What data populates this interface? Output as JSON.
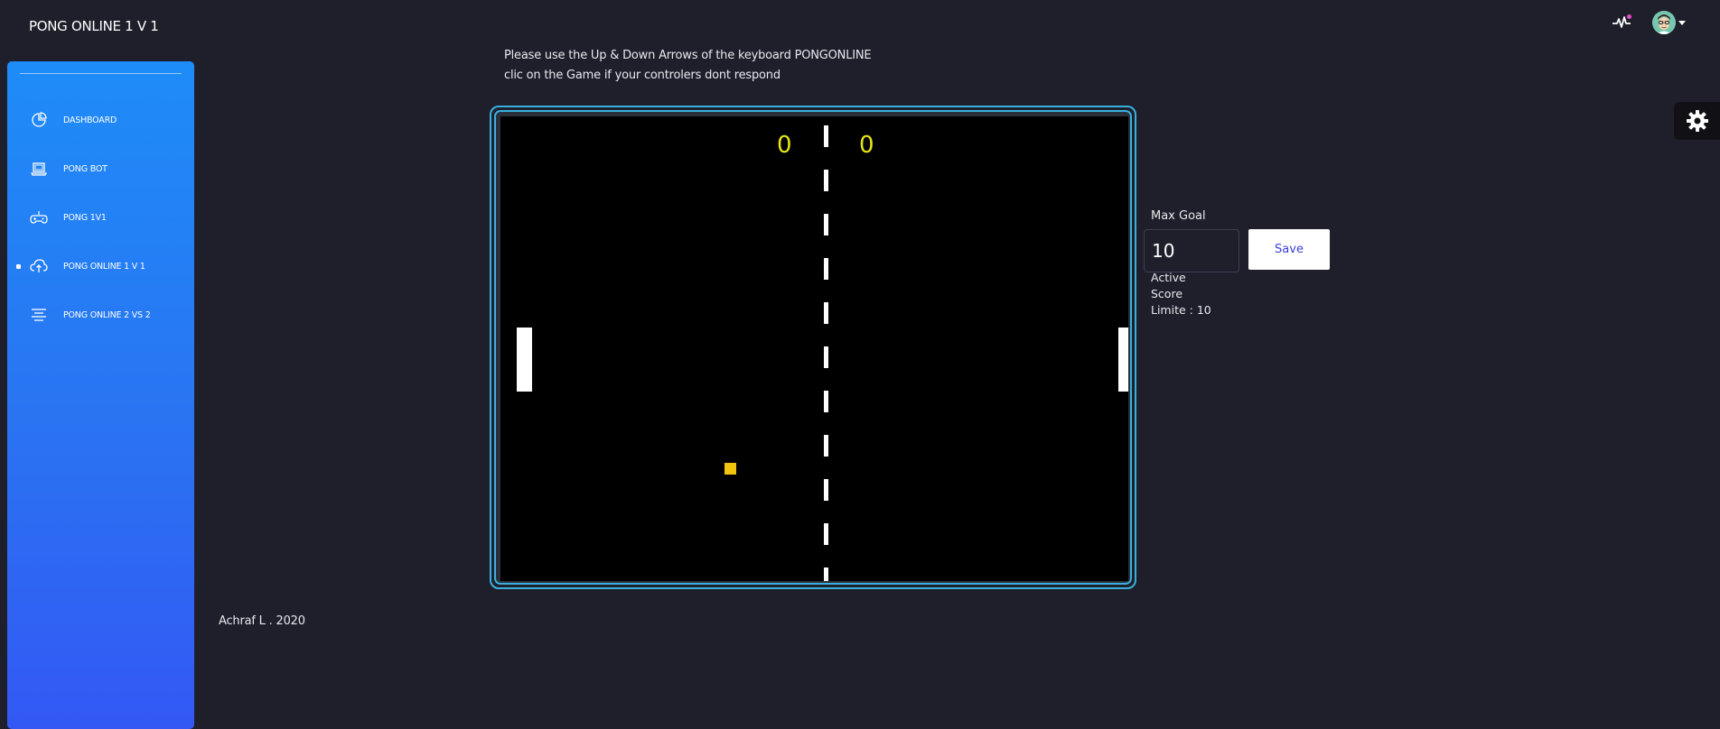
{
  "header": {
    "title": "PONG ONLINE 1 V 1"
  },
  "sidebar": {
    "items": [
      {
        "label": "DASHBOARD",
        "icon": "chart-pie-icon",
        "active": false
      },
      {
        "label": "PONG BOT",
        "icon": "laptop-icon",
        "active": false
      },
      {
        "label": "PONG 1V1",
        "icon": "gamepad-icon",
        "active": false
      },
      {
        "label": "PONG ONLINE 1 V 1",
        "icon": "cloud-upload-icon",
        "active": true
      },
      {
        "label": "PONG ONLINE 2 VS 2",
        "icon": "align-center-icon",
        "active": false
      }
    ]
  },
  "instructions": {
    "line1": "Please use the Up & Down Arrows of the keyboard PONGONLINE",
    "line2": "clic on the Game if your controlers dont respond"
  },
  "game": {
    "score_left": "0",
    "score_right": "0",
    "colors": {
      "court": "#000000",
      "score": "#e5e516",
      "ball": "#f1c40f",
      "paddle": "#ffffff",
      "frame": "#38b0de"
    }
  },
  "settings": {
    "max_goal_label": "Max Goal",
    "max_goal_value": "10",
    "save_label": "Save",
    "status_text": "Active Score Limite : 10"
  },
  "footer": {
    "text": "Achraf L . 2020"
  },
  "theme": {
    "background": "#1f1f2b",
    "sidebar_gradient_top": "#1e8cf8",
    "sidebar_gradient_bottom": "#3358f4",
    "notification_dot": "#e14eca",
    "save_text": "#3b3fd1"
  }
}
